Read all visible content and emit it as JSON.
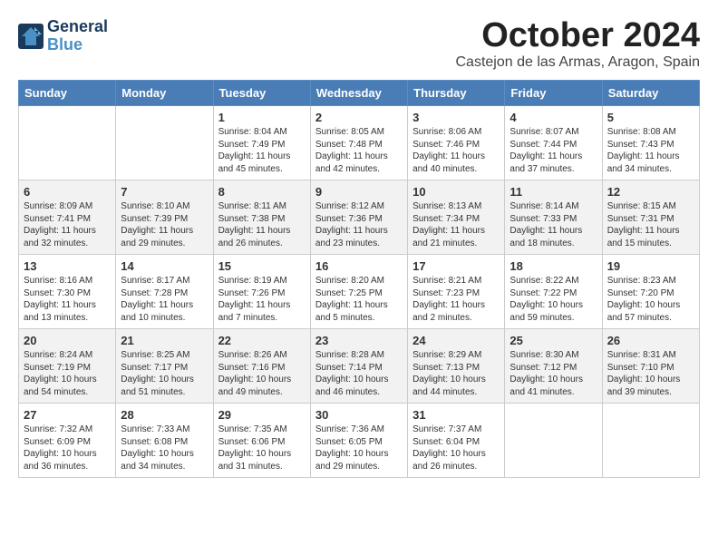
{
  "logo": {
    "line1": "General",
    "line2": "Blue"
  },
  "title": "October 2024",
  "subtitle": "Castejon de las Armas, Aragon, Spain",
  "headers": [
    "Sunday",
    "Monday",
    "Tuesday",
    "Wednesday",
    "Thursday",
    "Friday",
    "Saturday"
  ],
  "weeks": [
    [
      {
        "day": "",
        "content": ""
      },
      {
        "day": "",
        "content": ""
      },
      {
        "day": "1",
        "content": "Sunrise: 8:04 AM\nSunset: 7:49 PM\nDaylight: 11 hours and 45 minutes."
      },
      {
        "day": "2",
        "content": "Sunrise: 8:05 AM\nSunset: 7:48 PM\nDaylight: 11 hours and 42 minutes."
      },
      {
        "day": "3",
        "content": "Sunrise: 8:06 AM\nSunset: 7:46 PM\nDaylight: 11 hours and 40 minutes."
      },
      {
        "day": "4",
        "content": "Sunrise: 8:07 AM\nSunset: 7:44 PM\nDaylight: 11 hours and 37 minutes."
      },
      {
        "day": "5",
        "content": "Sunrise: 8:08 AM\nSunset: 7:43 PM\nDaylight: 11 hours and 34 minutes."
      }
    ],
    [
      {
        "day": "6",
        "content": "Sunrise: 8:09 AM\nSunset: 7:41 PM\nDaylight: 11 hours and 32 minutes."
      },
      {
        "day": "7",
        "content": "Sunrise: 8:10 AM\nSunset: 7:39 PM\nDaylight: 11 hours and 29 minutes."
      },
      {
        "day": "8",
        "content": "Sunrise: 8:11 AM\nSunset: 7:38 PM\nDaylight: 11 hours and 26 minutes."
      },
      {
        "day": "9",
        "content": "Sunrise: 8:12 AM\nSunset: 7:36 PM\nDaylight: 11 hours and 23 minutes."
      },
      {
        "day": "10",
        "content": "Sunrise: 8:13 AM\nSunset: 7:34 PM\nDaylight: 11 hours and 21 minutes."
      },
      {
        "day": "11",
        "content": "Sunrise: 8:14 AM\nSunset: 7:33 PM\nDaylight: 11 hours and 18 minutes."
      },
      {
        "day": "12",
        "content": "Sunrise: 8:15 AM\nSunset: 7:31 PM\nDaylight: 11 hours and 15 minutes."
      }
    ],
    [
      {
        "day": "13",
        "content": "Sunrise: 8:16 AM\nSunset: 7:30 PM\nDaylight: 11 hours and 13 minutes."
      },
      {
        "day": "14",
        "content": "Sunrise: 8:17 AM\nSunset: 7:28 PM\nDaylight: 11 hours and 10 minutes."
      },
      {
        "day": "15",
        "content": "Sunrise: 8:19 AM\nSunset: 7:26 PM\nDaylight: 11 hours and 7 minutes."
      },
      {
        "day": "16",
        "content": "Sunrise: 8:20 AM\nSunset: 7:25 PM\nDaylight: 11 hours and 5 minutes."
      },
      {
        "day": "17",
        "content": "Sunrise: 8:21 AM\nSunset: 7:23 PM\nDaylight: 11 hours and 2 minutes."
      },
      {
        "day": "18",
        "content": "Sunrise: 8:22 AM\nSunset: 7:22 PM\nDaylight: 10 hours and 59 minutes."
      },
      {
        "day": "19",
        "content": "Sunrise: 8:23 AM\nSunset: 7:20 PM\nDaylight: 10 hours and 57 minutes."
      }
    ],
    [
      {
        "day": "20",
        "content": "Sunrise: 8:24 AM\nSunset: 7:19 PM\nDaylight: 10 hours and 54 minutes."
      },
      {
        "day": "21",
        "content": "Sunrise: 8:25 AM\nSunset: 7:17 PM\nDaylight: 10 hours and 51 minutes."
      },
      {
        "day": "22",
        "content": "Sunrise: 8:26 AM\nSunset: 7:16 PM\nDaylight: 10 hours and 49 minutes."
      },
      {
        "day": "23",
        "content": "Sunrise: 8:28 AM\nSunset: 7:14 PM\nDaylight: 10 hours and 46 minutes."
      },
      {
        "day": "24",
        "content": "Sunrise: 8:29 AM\nSunset: 7:13 PM\nDaylight: 10 hours and 44 minutes."
      },
      {
        "day": "25",
        "content": "Sunrise: 8:30 AM\nSunset: 7:12 PM\nDaylight: 10 hours and 41 minutes."
      },
      {
        "day": "26",
        "content": "Sunrise: 8:31 AM\nSunset: 7:10 PM\nDaylight: 10 hours and 39 minutes."
      }
    ],
    [
      {
        "day": "27",
        "content": "Sunrise: 7:32 AM\nSunset: 6:09 PM\nDaylight: 10 hours and 36 minutes."
      },
      {
        "day": "28",
        "content": "Sunrise: 7:33 AM\nSunset: 6:08 PM\nDaylight: 10 hours and 34 minutes."
      },
      {
        "day": "29",
        "content": "Sunrise: 7:35 AM\nSunset: 6:06 PM\nDaylight: 10 hours and 31 minutes."
      },
      {
        "day": "30",
        "content": "Sunrise: 7:36 AM\nSunset: 6:05 PM\nDaylight: 10 hours and 29 minutes."
      },
      {
        "day": "31",
        "content": "Sunrise: 7:37 AM\nSunset: 6:04 PM\nDaylight: 10 hours and 26 minutes."
      },
      {
        "day": "",
        "content": ""
      },
      {
        "day": "",
        "content": ""
      }
    ]
  ]
}
